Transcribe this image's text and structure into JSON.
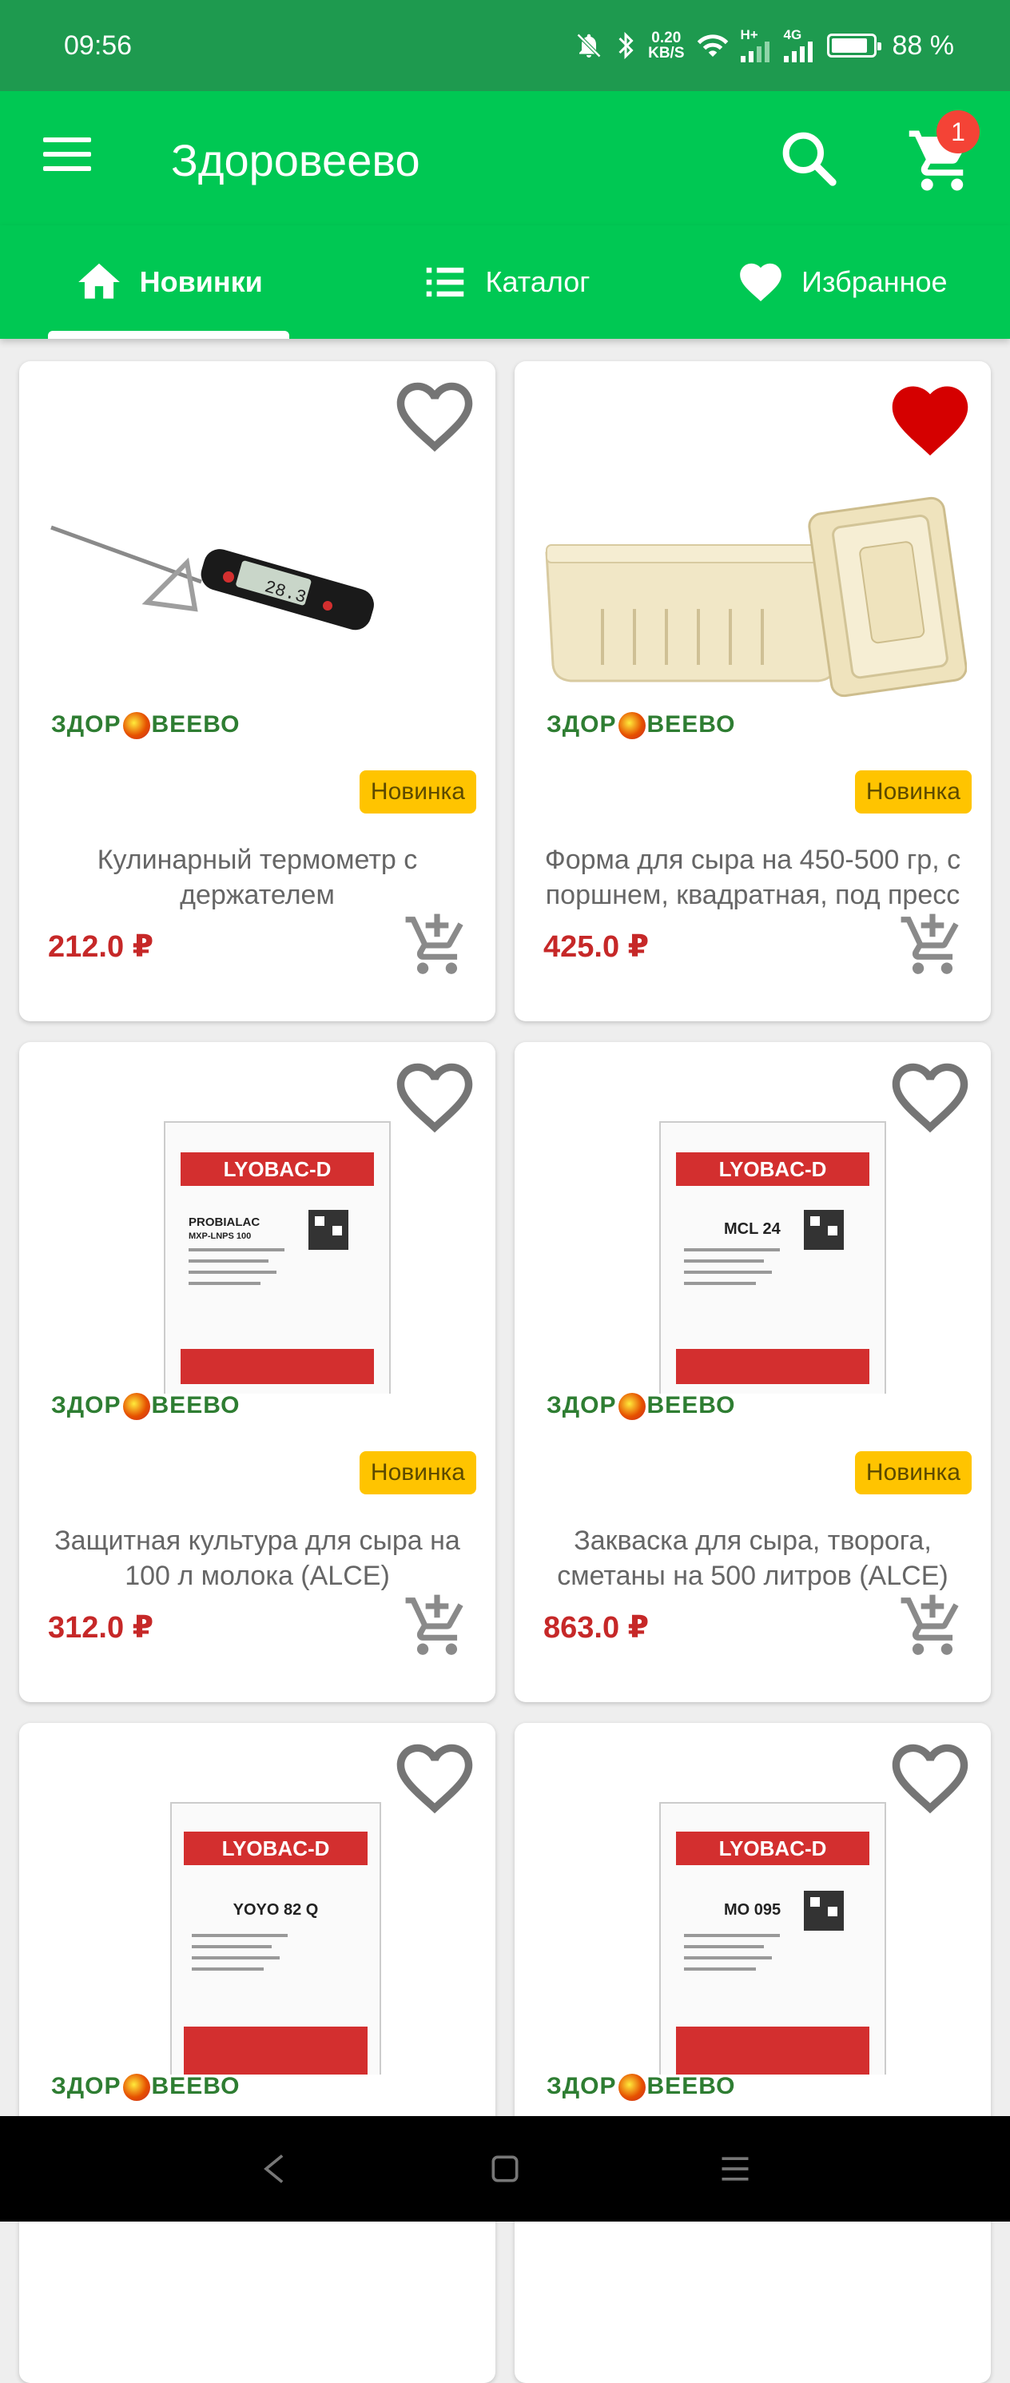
{
  "status_bar": {
    "time": "09:56",
    "net_speed": "0.20",
    "net_unit": "KB/S",
    "signal_2": "H+",
    "signal_1": "4G",
    "battery": "88 %",
    "battery_level": 0.88
  },
  "app_bar": {
    "title": "Здоровеево",
    "cart_count": "1"
  },
  "tabs": [
    {
      "label": "Новинки",
      "icon": "home-icon",
      "active": true
    },
    {
      "label": "Каталог",
      "icon": "list-icon",
      "active": false
    },
    {
      "label": "Избранное",
      "icon": "heart-icon",
      "active": false
    }
  ],
  "products": [
    {
      "title": "Кулинарный термометр с держателем",
      "price": "212.0 ₽",
      "badge": "Новинка",
      "favorite": false,
      "logo": "ЗДОРОВЕЕВО",
      "image": "thermometer"
    },
    {
      "title": "Форма для сыра на 450-500 гр, с поршнем, квадратная, под пресс",
      "price": "425.0 ₽",
      "badge": "Новинка",
      "favorite": true,
      "logo": "ЗДОРОВЕЕВО",
      "image": "cheese-mold"
    },
    {
      "title": "Защитная культура для сыра на 100 л молока (ALCE)",
      "price": "312.0 ₽",
      "badge": "Новинка",
      "favorite": false,
      "logo": "ЗДОРОВЕЕВО",
      "image": "lyobac-probialac"
    },
    {
      "title": "Закваска для сыра, творога, сметаны на 500 литров (ALCE)",
      "price": "863.0 ₽",
      "badge": "Новинка",
      "favorite": false,
      "logo": "ЗДОРОВЕЕВО",
      "image": "lyobac-mcl24"
    },
    {
      "title": "",
      "price": "",
      "badge": "",
      "favorite": false,
      "logo": "ЗДОРОВЕЕВО",
      "image": "lyobac-yoyo82q"
    },
    {
      "title": "",
      "price": "",
      "badge": "",
      "favorite": false,
      "logo": "ЗДОРОВЕЕВО",
      "image": "lyobac-mo095"
    }
  ],
  "packets": {
    "brand": "LYOBAC-D",
    "probialac": "PROBIALAC",
    "probialac_sub": "MXP-LNPS 100",
    "mcl24": "MCL 24",
    "yoyo": "YOYO 82 Q",
    "mo095": "MO 095",
    "thermo_reading": "28.3"
  },
  "colors": {
    "accent": "#00c853",
    "status_bar": "#1e9a4f",
    "price": "#c62828",
    "badge": "#ffc400",
    "favorite_active": "#d50000",
    "icon_gray": "#757575"
  }
}
